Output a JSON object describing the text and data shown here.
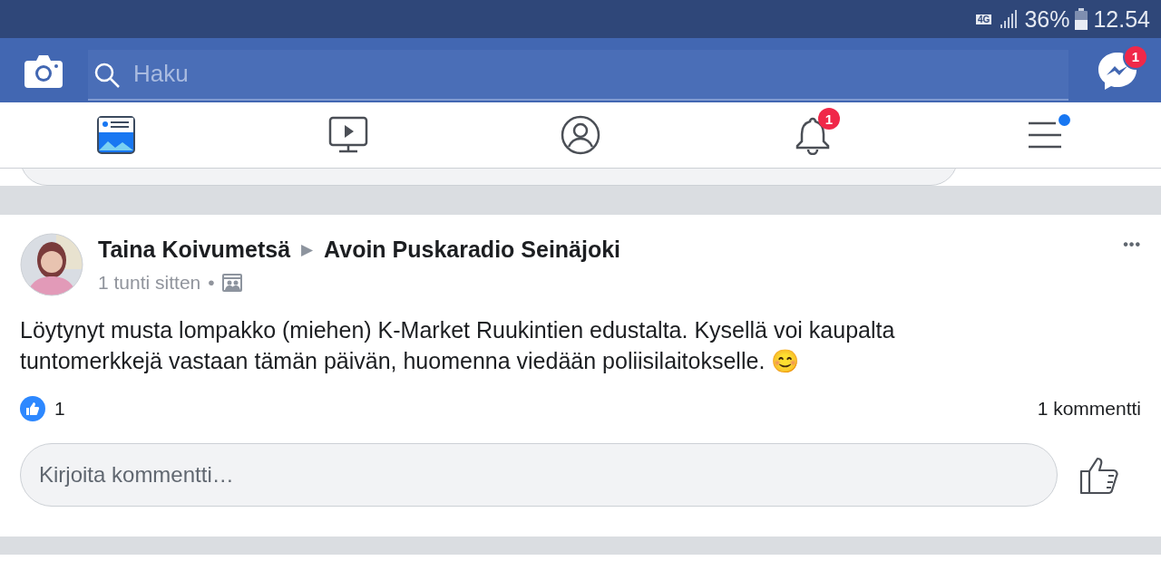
{
  "status_bar": {
    "network": "4G",
    "battery": "36%",
    "time": "12.54"
  },
  "header": {
    "search": {
      "placeholder": "Haku"
    },
    "messenger_badge": "1"
  },
  "tabs": [
    {
      "kind": "news",
      "selected": true
    },
    {
      "kind": "video",
      "selected": false
    },
    {
      "kind": "profile",
      "selected": false
    },
    {
      "kind": "bell",
      "selected": false,
      "badge": "1"
    },
    {
      "kind": "menu",
      "selected": false,
      "dot": true
    }
  ],
  "post": {
    "author": "Taina Koivumetsä",
    "separator": "▶",
    "group": "Avoin Puskaradio Seinäjoki",
    "time": "1 tunti sitten",
    "dot": "•",
    "more": "•••",
    "text": "Löytynyt musta lompakko (miehen) K-Market Ruukintien edustalta. Kysellä voi kaupalta tuntomerkkejä vastaan tämän päivän, huomenna viedään poliisilaitokselle. 😊",
    "likes": "1",
    "comments": "1 kommentti",
    "comment_field": {
      "placeholder": "Kirjoita kommentti…"
    }
  }
}
